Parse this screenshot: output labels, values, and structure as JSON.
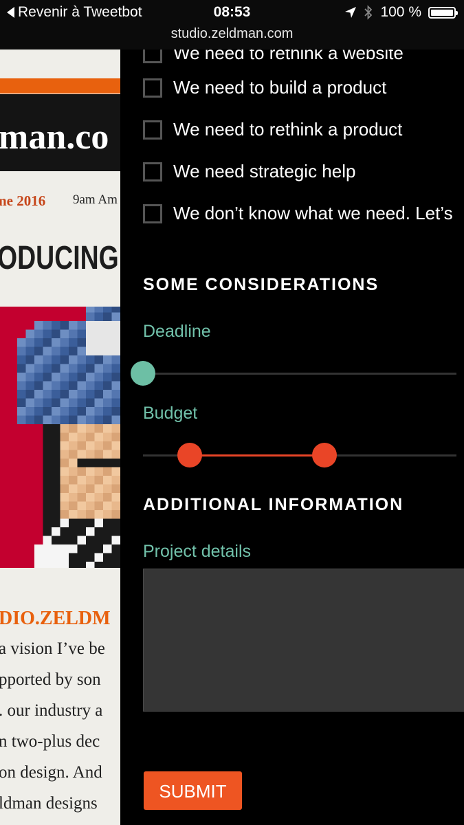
{
  "status_bar": {
    "back_label": "Revenir à Tweetbot",
    "time": "08:53",
    "battery": "100 %",
    "url": "studio.zeldman.com"
  },
  "background_page": {
    "logo": "man.co",
    "date": "ne 2016",
    "time": "9am Am",
    "heading": "ODUCING S",
    "subhead": "DIO.ZELDM",
    "body_lines": [
      "a vision I’ve be",
      "pported by son",
      ". our industry a",
      "n two-plus dec",
      "on design. And",
      "ldman designs"
    ],
    "colors": {
      "accent": "#e8610e",
      "art": "#c3002f"
    }
  },
  "form": {
    "checkboxes": [
      {
        "label": "We need to rethink a website",
        "checked": false
      },
      {
        "label": "We need to build a product",
        "checked": false
      },
      {
        "label": "We need to rethink a product",
        "checked": false
      },
      {
        "label": "We need strategic help",
        "checked": false
      },
      {
        "label": "We don’t know what we need. Let’s",
        "checked": false
      }
    ],
    "considerations_title": "SOME CONSIDERATIONS",
    "deadline_label": "Deadline",
    "deadline_value": 0,
    "budget_label": "Budget",
    "budget_range": [
      0.15,
      0.58
    ],
    "additional_title": "ADDITIONAL INFORMATION",
    "project_details_label": "Project details",
    "project_details_value": "",
    "submit_label": "SUBMIT",
    "colors": {
      "label": "#71c1aa",
      "slider_teal": "#6dbfa5",
      "slider_red": "#e94527",
      "submit": "#ee5522"
    }
  }
}
